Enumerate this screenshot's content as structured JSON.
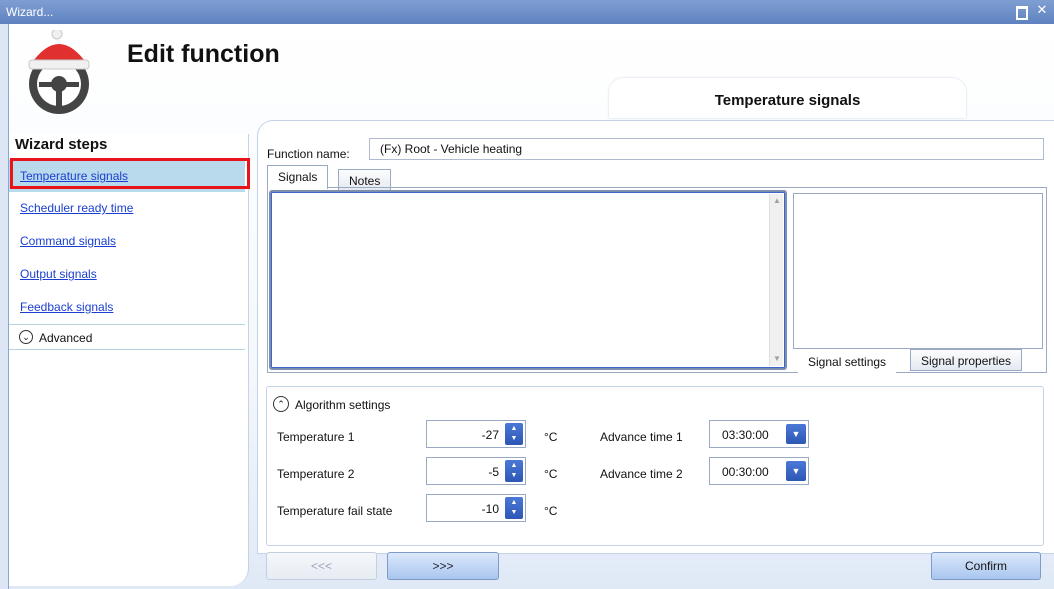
{
  "window": {
    "title": "Wizard..."
  },
  "header": {
    "title": "Edit function",
    "step_tab": "Temperature signals"
  },
  "sidebar": {
    "title": "Wizard steps",
    "items": [
      {
        "label": "Temperature signals"
      },
      {
        "label": "Scheduler ready time"
      },
      {
        "label": "Command signals"
      },
      {
        "label": "Output signals"
      },
      {
        "label": "Feedback signals"
      }
    ],
    "advanced_label": "Advanced"
  },
  "main": {
    "function_name_label": "Function name:",
    "function_name_value": "(Fx) Root - Vehicle heating",
    "tabs": [
      {
        "label": "Signals"
      },
      {
        "label": "Notes"
      }
    ],
    "panel_tabs": [
      {
        "label": "Signal settings"
      },
      {
        "label": "Signal properties"
      }
    ],
    "algorithm": {
      "title": "Algorithm settings",
      "temperature_1": {
        "label": "Temperature 1",
        "value": "-27",
        "unit": "°C"
      },
      "temperature_2": {
        "label": "Temperature 2",
        "value": "-5",
        "unit": "°C"
      },
      "temperature_fail": {
        "label": "Temperature fail state",
        "value": "-10",
        "unit": "°C"
      },
      "advance_time_1": {
        "label": "Advance time 1",
        "value": "03:30:00"
      },
      "advance_time_2": {
        "label": "Advance time 2",
        "value": "00:30:00"
      }
    }
  },
  "footer": {
    "back_label": "<<<",
    "next_label": ">>>",
    "confirm_label": "Confirm"
  }
}
